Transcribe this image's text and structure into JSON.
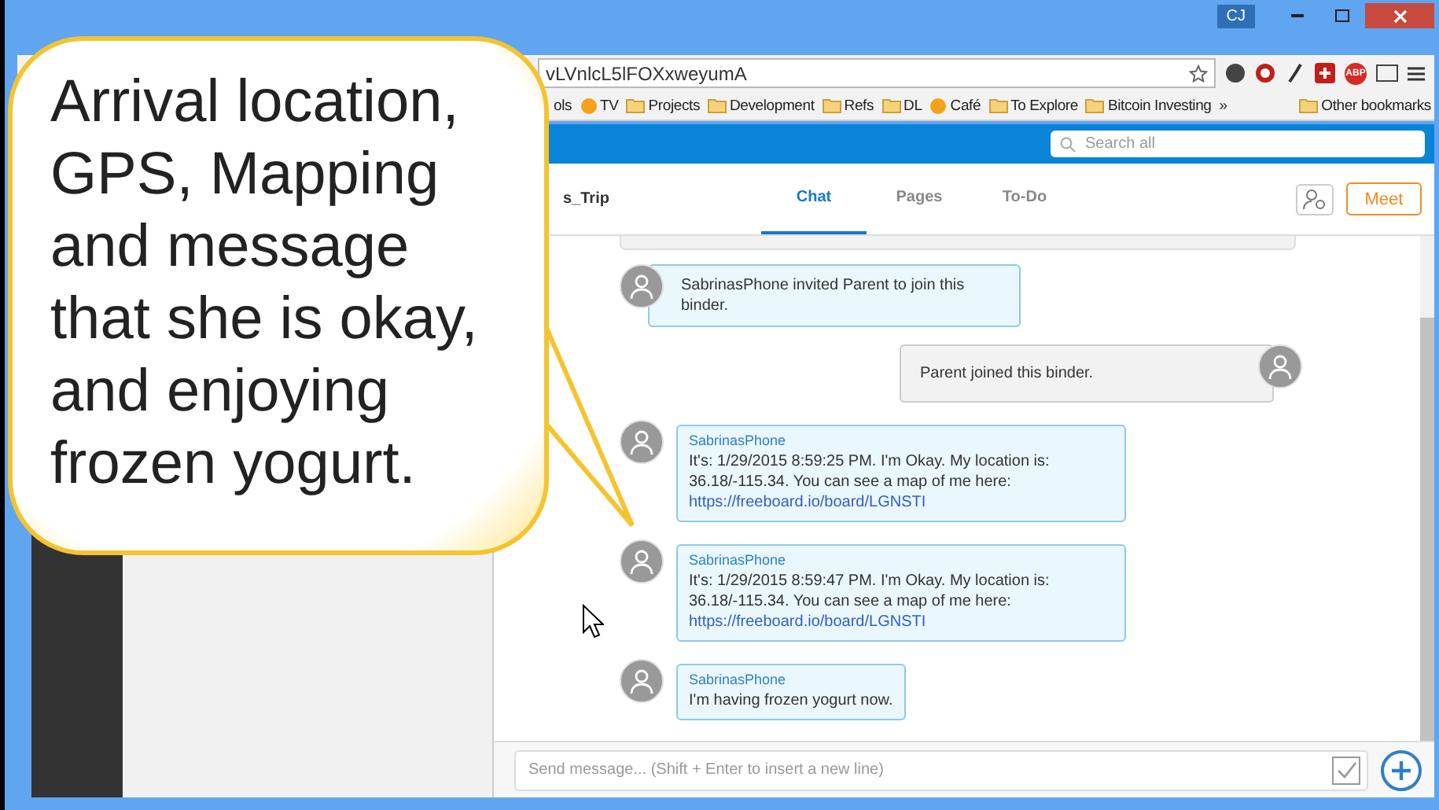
{
  "window": {
    "profile": "CJ"
  },
  "toolbar": {
    "url": "vLVnlcL5lFOXxweyumA",
    "adblock_label": "ABP"
  },
  "bookmarks": [
    {
      "label": "ols",
      "kind": "text"
    },
    {
      "label": "TV",
      "kind": "site"
    },
    {
      "label": "Projects",
      "kind": "folder"
    },
    {
      "label": "Development",
      "kind": "folder"
    },
    {
      "label": "Refs",
      "kind": "folder"
    },
    {
      "label": "DL",
      "kind": "folder"
    },
    {
      "label": "Café",
      "kind": "site"
    },
    {
      "label": "To Explore",
      "kind": "folder"
    },
    {
      "label": "Bitcoin Investing",
      "kind": "folder"
    },
    {
      "label": "»",
      "kind": "text"
    },
    {
      "label": "Other bookmarks",
      "kind": "folder"
    }
  ],
  "header": {
    "search": {
      "placeholder": "Search all"
    }
  },
  "binder": {
    "title": "s_Trip",
    "meet": "Meet",
    "tabs": [
      {
        "label": "Chat",
        "selected": true
      },
      {
        "label": "Pages",
        "selected": false
      },
      {
        "label": "To-Do",
        "selected": false
      }
    ]
  },
  "messages": [
    {
      "kind": "notice",
      "outgoing": false,
      "text": "SabrinasPhone invited Parent to join this binder."
    },
    {
      "kind": "notice",
      "outgoing": true,
      "text": "Parent joined this binder."
    },
    {
      "kind": "message",
      "outgoing": false,
      "sender": "SabrinasPhone",
      "text": "It's: 1/29/2015 8:59:25 PM. I'm Okay. My location is: 36.18/-115.34. You can see a map of me here: ",
      "link": "https://freeboard.io/board/LGNSTI"
    },
    {
      "kind": "message",
      "outgoing": false,
      "sender": "SabrinasPhone",
      "text": "It's: 1/29/2015 8:59:47 PM. I'm Okay. My location is: 36.18/-115.34. You can see a map of me here: ",
      "link": "https://freeboard.io/board/LGNSTI"
    },
    {
      "kind": "message",
      "outgoing": false,
      "sender": "SabrinasPhone",
      "text": "I'm having frozen yogurt now."
    }
  ],
  "composer": {
    "placeholder": "Send message... (Shift + Enter to insert a new line)"
  },
  "callout": {
    "text": "Arrival location, GPS, Mapping and message that she is okay, and enjoying frozen yogurt."
  }
}
